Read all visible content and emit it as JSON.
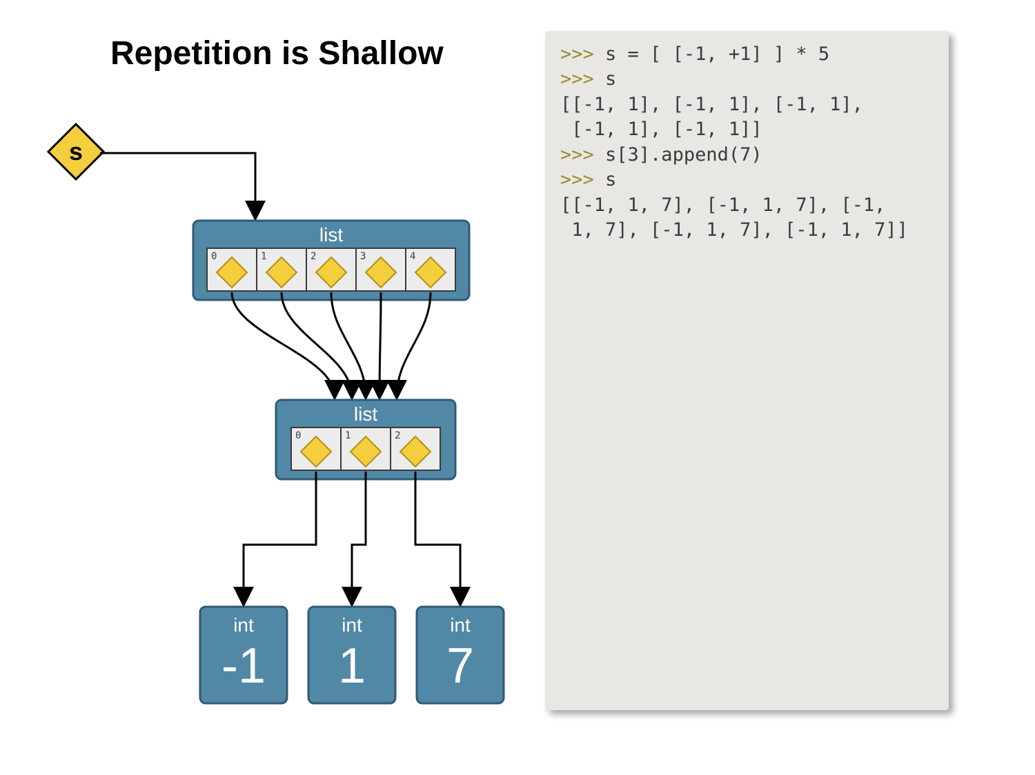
{
  "title": "Repetition is Shallow",
  "repl": {
    "lines": [
      {
        "prompt": ">>> ",
        "code": "s = [ [-1, +1] ] * 5"
      },
      {
        "prompt": ">>> ",
        "code": "s"
      },
      {
        "out": "[[-1, 1], [-1, 1], [-1, 1],\n [-1, 1], [-1, 1]]"
      },
      {
        "prompt": ">>> ",
        "code": "s[3].append(7)"
      },
      {
        "prompt": ">>> ",
        "code": "s"
      },
      {
        "out": "[[-1, 1, 7], [-1, 1, 7], [-1,\n 1, 7], [-1, 1, 7], [-1, 1, 7]]"
      }
    ]
  },
  "diagram": {
    "var_name": "s",
    "outer_list": {
      "label": "list",
      "indices": [
        "0",
        "1",
        "2",
        "3",
        "4"
      ]
    },
    "inner_list": {
      "label": "list",
      "indices": [
        "0",
        "1",
        "2"
      ]
    },
    "ints": [
      {
        "type": "int",
        "value": "-1"
      },
      {
        "type": "int",
        "value": "1"
      },
      {
        "type": "int",
        "value": "7"
      }
    ],
    "colors": {
      "box_fill": "#5188a6",
      "box_stroke": "#2f5a73",
      "cell_fill": "#ececec",
      "diamond_fill": "#f5ce3e",
      "diamond_stroke": "#b38f13",
      "arrow": "#000000",
      "text_on_box": "#ffffff"
    }
  }
}
